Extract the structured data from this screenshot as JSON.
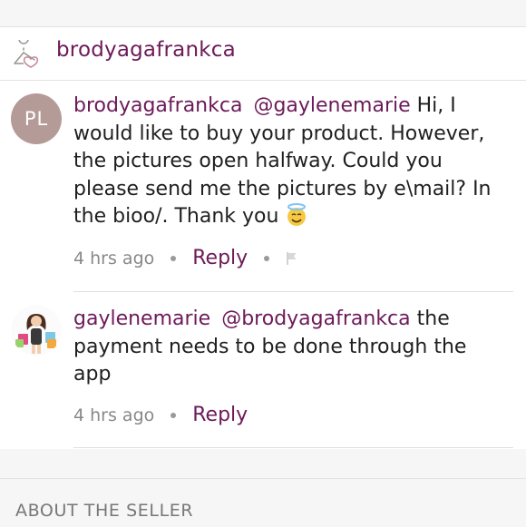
{
  "header": {
    "username": "brodyagafrankca",
    "icon": "closet-heart-icon"
  },
  "comments": [
    {
      "avatar_initials": "PL",
      "avatar_color": "#b49b98",
      "author": "brodyagafrankca",
      "mention": "@gaylenemarie",
      "text": "Hi, I would like to buy your product. However, the pictures open halfway. Could you please send me the pictures by e\\mail? In the bioo/. Thank you",
      "emoji": "smiling-face-with-halo-icon",
      "time": "4 hrs ago",
      "reply_label": "Reply",
      "flag_icon": "flag-icon"
    },
    {
      "avatar_icon": "shopper-avatar",
      "author": "gaylenemarie",
      "mention": "@brodyagafrankca",
      "text": "the payment needs to be done through the app",
      "time": "4 hrs ago",
      "reply_label": "Reply"
    }
  ],
  "about": {
    "label": "ABOUT THE SELLER"
  },
  "colors": {
    "accent": "#6d1a59",
    "meta": "#888888",
    "background": "#f7f6f6"
  }
}
